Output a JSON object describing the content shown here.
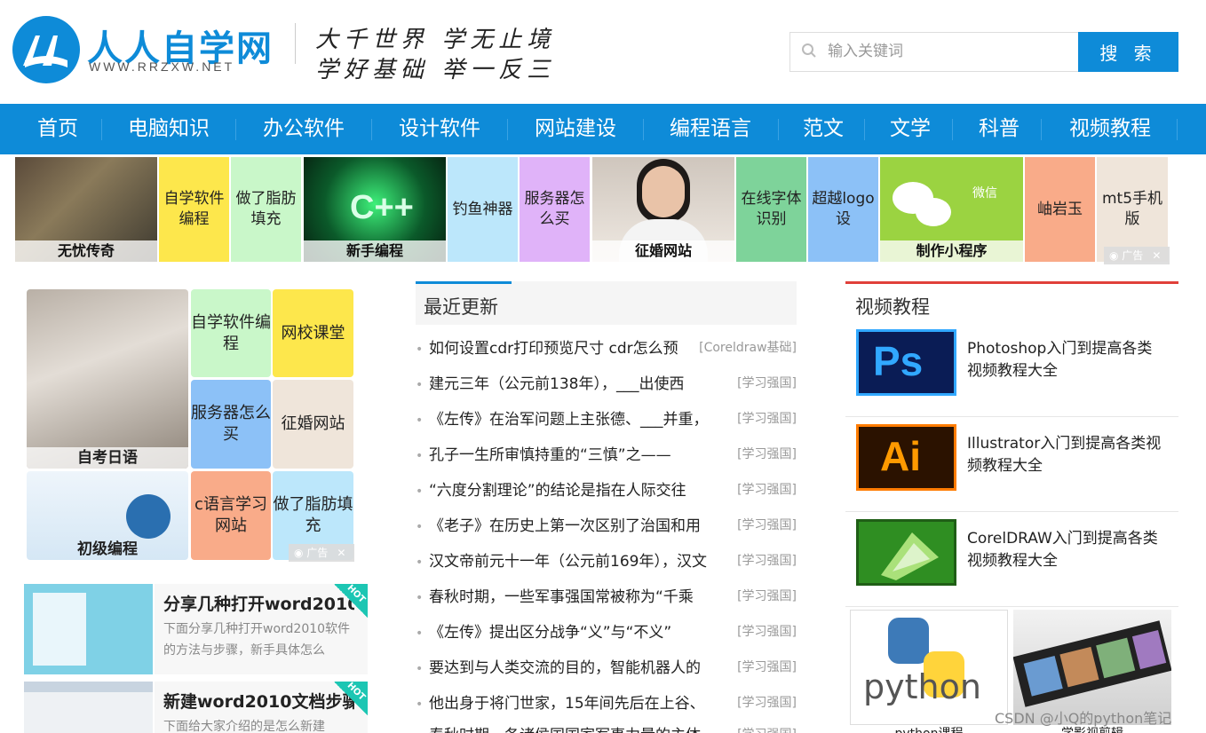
{
  "header": {
    "logo_text": "人人自学网",
    "logo_url": "WWW.RRZXW.NET",
    "slogan_line1": "大千世界  学无止境",
    "slogan_line2": "学好基础  举一反三",
    "search_placeholder": "输入关键词",
    "search_button": "搜 索"
  },
  "nav": [
    "首页",
    "电脑知识",
    "办公软件",
    "设计软件",
    "网站建设",
    "编程语言",
    "范文",
    "文学",
    "科普",
    "视频教程"
  ],
  "ad_strip": [
    {
      "label": "无忧传奇",
      "kind": "image"
    },
    {
      "label": "自学软件编程",
      "kind": "text",
      "color": "#fde74c"
    },
    {
      "label": "做了脂肪填充",
      "kind": "text",
      "color": "#c9f7c9"
    },
    {
      "label": "新手编程",
      "kind": "image"
    },
    {
      "label": "钓鱼神器",
      "kind": "text",
      "color": "#bce7fb"
    },
    {
      "label": "服务器怎么买",
      "kind": "text",
      "color": "#e0b3f9"
    },
    {
      "label": "征婚网站",
      "kind": "image"
    },
    {
      "label": "在线字体识别",
      "kind": "text",
      "color": "#7ed39a"
    },
    {
      "label": "超越logo设",
      "kind": "text",
      "color": "#8cc1f7"
    },
    {
      "label": "制作小程序",
      "kind": "image"
    },
    {
      "label": "岫岩玉",
      "kind": "text",
      "color": "#f9ab89"
    },
    {
      "label": "mt5手机版",
      "kind": "text",
      "color": "#efe5da"
    }
  ],
  "ad_badge": "广告",
  "left_grid": [
    {
      "label": "自考日语",
      "kind": "image"
    },
    {
      "label": "自学软件编程",
      "color": "#c9f7c9"
    },
    {
      "label": "网校课堂",
      "color": "#fde74c"
    },
    {
      "label": "服务器怎么买",
      "color": "#8cc1f7"
    },
    {
      "label": "征婚网站",
      "color": "#efe5da"
    },
    {
      "label": "初级编程",
      "kind": "image"
    },
    {
      "label": "c语言学习网站",
      "color": "#f9ab89"
    },
    {
      "label": "做了脂肪填充",
      "color": "#bce7fb"
    }
  ],
  "left_cards": [
    {
      "title": "分享几种打开word2010",
      "desc": "下面分享几种打开word2010软件的方法与步骤，新手具体怎么",
      "hot": "HOT"
    },
    {
      "title": "新建word2010文档步骤",
      "desc": "下面给大家介绍的是怎么新建",
      "hot": "HOT"
    }
  ],
  "recent": {
    "title": "最近更新",
    "items": [
      {
        "text": "如何设置cdr打印预览尺寸 cdr怎么预",
        "cat": "[Coreldraw基础]"
      },
      {
        "text": "建元三年（公元前138年），___出使西",
        "cat": "[学习强国]"
      },
      {
        "text": "《左传》在治军问题上主张德、___并重，",
        "cat": "[学习强国]"
      },
      {
        "text": "孔子一生所审慎持重的“三慎”之——",
        "cat": "[学习强国]"
      },
      {
        "text": "“六度分割理论”的结论是指在人际交往",
        "cat": "[学习强国]"
      },
      {
        "text": "《老子》在历史上第一次区别了治国和用",
        "cat": "[学习强国]"
      },
      {
        "text": "汉文帝前元十一年（公元前169年），汉文",
        "cat": "[学习强国]"
      },
      {
        "text": "春秋时期，一些军事强国常被称为“千乘",
        "cat": "[学习强国]"
      },
      {
        "text": "《左传》提出区分战争“义”与“不义”",
        "cat": "[学习强国]"
      },
      {
        "text": "要达到与人类交流的目的，智能机器人的",
        "cat": "[学习强国]"
      },
      {
        "text": "他出身于将门世家，15年间先后在上谷、",
        "cat": "[学习强国]"
      },
      {
        "text": "春秋时期，各诸侯国国家军事力量的主体",
        "cat": "[学习强国]"
      }
    ]
  },
  "video": {
    "title": "视频教程",
    "items": [
      {
        "icon": "Ps",
        "text": "Photoshop入门到提高各类视频教程大全"
      },
      {
        "icon": "Ai",
        "text": "Illustrator入门到提高各类视频教程大全"
      },
      {
        "icon": "corel",
        "text": "CorelDRAW入门到提高各类视频教程大全"
      }
    ],
    "bottom": [
      {
        "label": "python课程",
        "img_text": "python"
      },
      {
        "label": "学影视剪辑"
      }
    ]
  },
  "watermark": "CSDN @小Q的python笔记",
  "colors": {
    "brand": "#0e8bd8",
    "accent_red": "#e0403a"
  }
}
